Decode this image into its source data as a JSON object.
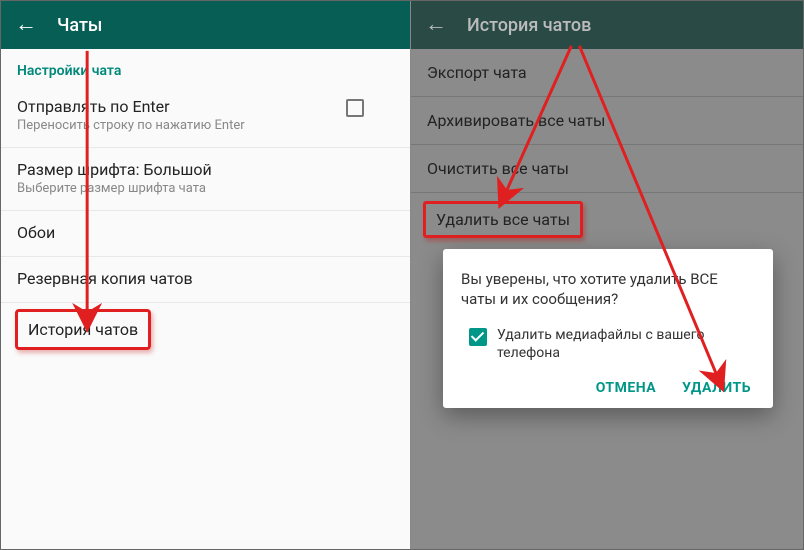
{
  "left": {
    "header_title": "Чаты",
    "section_title": "Настройки чата",
    "rows": {
      "enter": {
        "title": "Отправлять по Enter",
        "sub": "Переносить строку по нажатию Enter"
      },
      "font": {
        "title": "Размер шрифта: Большой",
        "sub": "Выберите размер шрифта чата"
      },
      "wall": {
        "title": "Обои"
      },
      "backup": {
        "title": "Резервная копия чатов"
      }
    },
    "history_label": "История чатов"
  },
  "right": {
    "header_title": "История чатов",
    "rows": {
      "export": "Экспорт чата",
      "archive": "Архивировать все чаты",
      "clear": "Очистить все чаты"
    },
    "delete_all_label": "Удалить все чаты",
    "dialog": {
      "text": "Вы уверены, что хотите удалить ВСЕ чаты и их сообщения?",
      "check_label": "Удалить медиафайлы с вашего телефона",
      "cancel": "ОТМЕНА",
      "confirm": "УДАЛИТЬ"
    }
  },
  "annotation_color": "#e02020"
}
